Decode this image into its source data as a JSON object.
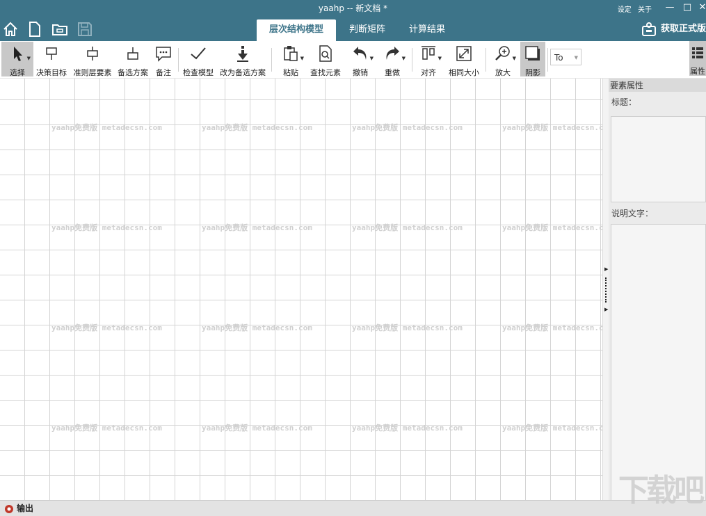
{
  "window": {
    "title": "yaahp -- 新文档 *",
    "links": [
      "设定",
      "关于"
    ],
    "buttons": {
      "minimize": "—",
      "maximize": "□",
      "close": "✕"
    }
  },
  "quick_access": [
    "home-icon",
    "new-document-icon",
    "open-folder-icon",
    "save-icon"
  ],
  "tabs": [
    {
      "label": "层次结构模型",
      "active": true
    },
    {
      "label": "判断矩阵",
      "active": false
    },
    {
      "label": "计算结果",
      "active": false
    }
  ],
  "license_button": "获取正式版",
  "toolbar": {
    "items": [
      {
        "label": "选择",
        "icon": "pointer-icon",
        "selected": true
      },
      {
        "label": "决策目标",
        "icon": "goal-node-icon"
      },
      {
        "label": "准则层要素",
        "icon": "criteria-node-icon"
      },
      {
        "label": "备选方案",
        "icon": "alternative-node-icon"
      },
      {
        "label": "备注",
        "icon": "comment-icon"
      },
      {
        "label": "检查模型",
        "icon": "check-icon"
      },
      {
        "label": "改为备选方案",
        "icon": "convert-down-icon"
      },
      {
        "label": "粘贴",
        "icon": "paste-icon"
      },
      {
        "label": "查找元素",
        "icon": "find-icon"
      },
      {
        "label": "撤销",
        "icon": "undo-icon"
      },
      {
        "label": "重做",
        "icon": "redo-icon"
      },
      {
        "label": "对齐",
        "icon": "align-icon"
      },
      {
        "label": "相同大小",
        "icon": "same-size-icon"
      },
      {
        "label": "放大",
        "icon": "zoom-in-icon"
      },
      {
        "label": "阴影",
        "icon": "shadow-icon",
        "selected": true
      }
    ],
    "combo_value": "To",
    "props_toggle_label": "属性"
  },
  "canvas": {
    "watermark_text": "yaahp免费版 metadecsn.com"
  },
  "properties_panel": {
    "header": "要素属性",
    "title_label": "标题：",
    "desc_label": "说明文字："
  },
  "status": {
    "output_label": "输出",
    "site_watermark": "下载吧"
  },
  "colors": {
    "brand": "#3d7489",
    "selected": "#c8c8c8"
  }
}
